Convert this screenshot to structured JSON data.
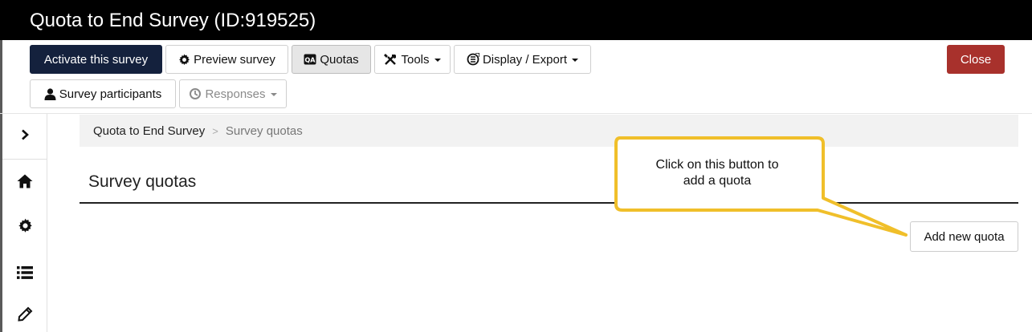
{
  "window": {
    "title": "Quota to End Survey (ID:919525)"
  },
  "toolbar": {
    "activate_label": "Activate this survey",
    "preview_label": "Preview survey",
    "quotas_label": "Quotas",
    "tools_label": "Tools",
    "display_export_label": "Display / Export",
    "close_label": "Close",
    "participants_label": "Survey participants",
    "responses_label": "Responses"
  },
  "sidebar": {
    "items": [
      {
        "icon": "chevron-right-icon"
      },
      {
        "icon": "home-icon"
      },
      {
        "icon": "gear-icon"
      },
      {
        "icon": "list-icon"
      },
      {
        "icon": "pencil-icon"
      }
    ]
  },
  "breadcrumb": {
    "items": [
      "Quota to End Survey",
      "Survey quotas"
    ],
    "separator": ">"
  },
  "main": {
    "title": "Survey quotas",
    "add_button_label": "Add new quota"
  },
  "callout": {
    "line1": "Click on this button to",
    "line2": "add a quota"
  },
  "colors": {
    "titlebar": "#000000",
    "primary_button": "#14213d",
    "close_button": "#a8312c",
    "callout_border": "#f0bf2a"
  }
}
